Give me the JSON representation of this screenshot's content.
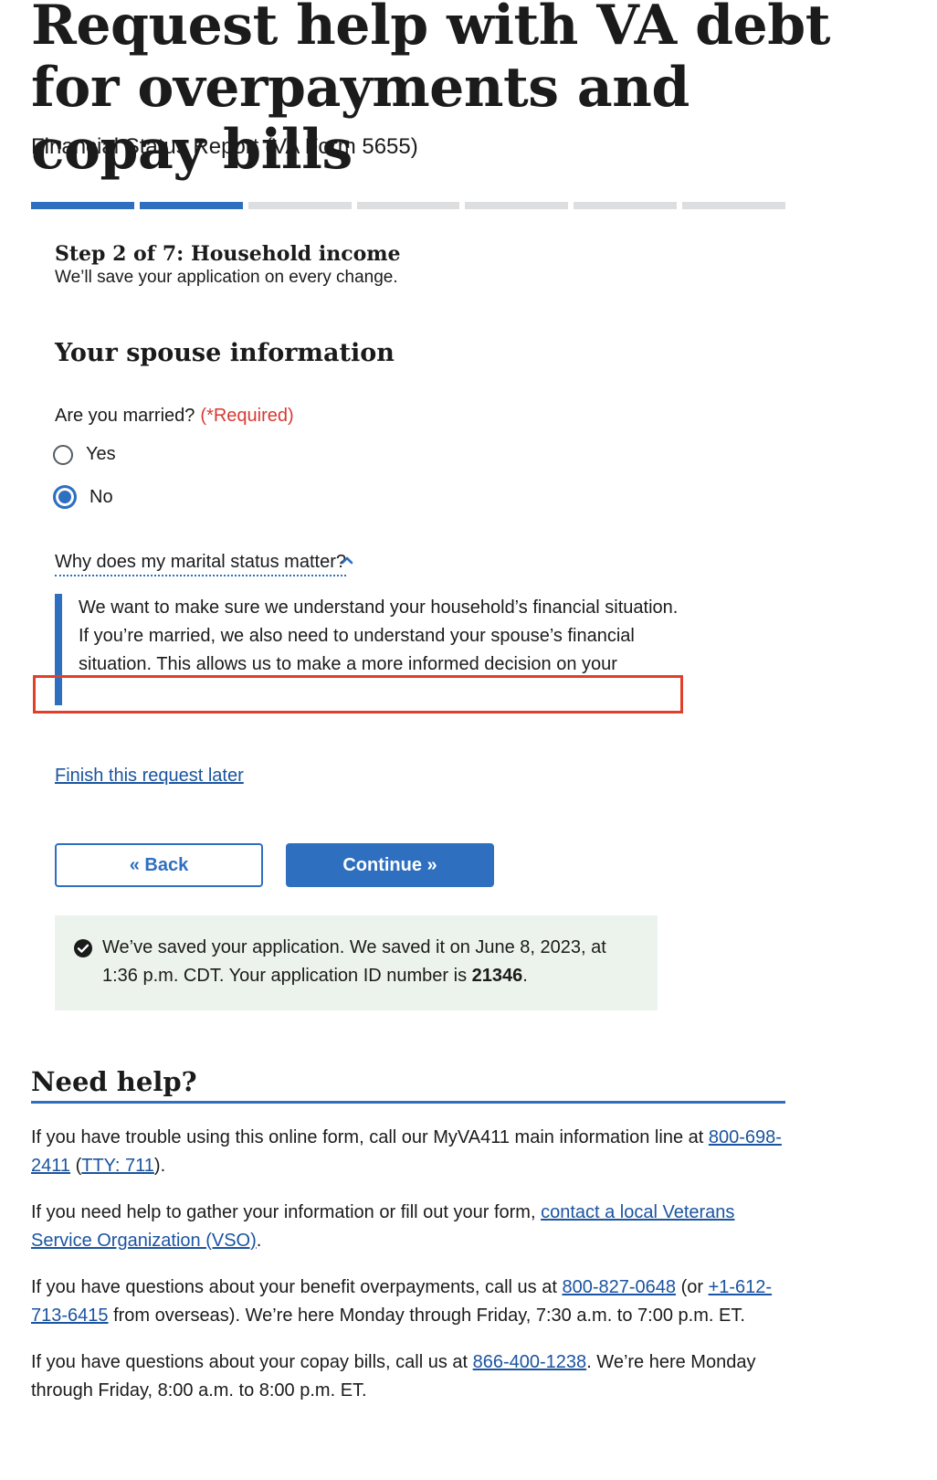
{
  "header": {
    "title": "Request help with VA debt for overpayments and copay bills",
    "subtitle": "Financial Status Report (VA Form 5655)"
  },
  "progress": {
    "total_steps": 7,
    "current_step": 2,
    "completed_segments": 2
  },
  "step": {
    "title": "Step 2 of 7: Household income",
    "subtitle": "We’ll save your application on every change."
  },
  "section": {
    "title": "Your spouse information"
  },
  "question": {
    "label": "Are you married?",
    "required": "(*Required)",
    "options": [
      {
        "label": "Yes",
        "checked": false
      },
      {
        "label": "No",
        "checked": true
      }
    ]
  },
  "additional_info": {
    "trigger": "Why does my marital status matter?",
    "para1": "We want to make sure we understand your household’s financial situation.",
    "para2": "If you’re married, we also need to understand your spouse’s financial situation. This allows us to make a more informed decision on your"
  },
  "actions": {
    "finish_later": "Finish this request later",
    "back": "« Back",
    "continue": "Continue »"
  },
  "saved_alert": {
    "text_before": "We’ve saved your application. We saved it on June 8, 2023, at 1:36 p.m. CDT. Your application ID number is ",
    "app_id": "21346",
    "text_after": "."
  },
  "help": {
    "title": "Need help?",
    "p1_text": "If you have trouble using this online form, call our MyVA411 main information line at ",
    "p1_phone": "800-698-2411",
    "p1_tty": "TTY: 711",
    "p2_text": "If you need help to gather your information or fill out your form, ",
    "p2_link": "contact a local Veterans Service Organization (VSO)",
    "p3_text": "If you have questions about your benefit overpayments, call us at ",
    "p3_phone": "800-827-0648",
    "p3_mid": " (or ",
    "p3_phone2": "+1-612-713-6415",
    "p3_end": " from overseas). We’re here Monday through Friday, 7:30 a.m. to 7:00 p.m. ET.",
    "p4_text": "If you have questions about your copay bills, call us at ",
    "p4_phone": "866-400-1238",
    "p4_end": ". We’re here Monday through Friday, 8:00 a.m. to 8:00 p.m. ET."
  },
  "colors": {
    "primary": "#2e6fbf",
    "required": "#d83933",
    "success_bg": "#ecf3ec",
    "highlight": "#e0402a"
  }
}
